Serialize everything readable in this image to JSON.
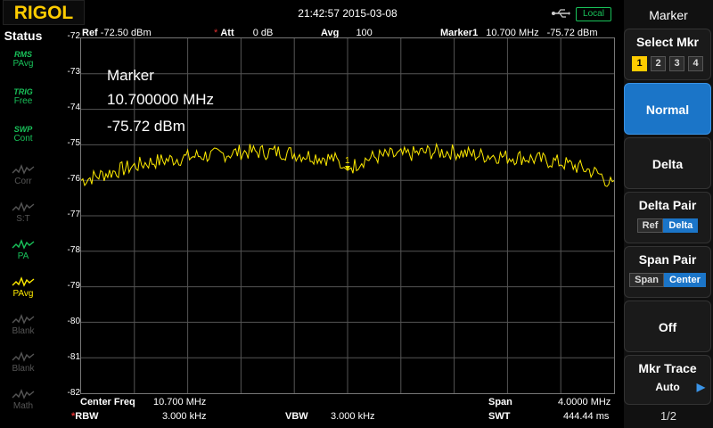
{
  "brand": "RIGOL",
  "header": {
    "datetime": "21:42:57 2015-03-08",
    "remote_badge": "Local"
  },
  "status": {
    "title": "Status",
    "items": [
      {
        "tag": "RMS",
        "label": "PAvg",
        "icon": "trace-avg-icon",
        "color": "#19c25a"
      },
      {
        "tag": "TRIG",
        "label": "Free",
        "icon": "trigger-icon",
        "color": "#19c25a"
      },
      {
        "tag": "SWP",
        "label": "Cont",
        "icon": "sweep-icon",
        "color": "#19c25a"
      },
      {
        "tag": "",
        "label": "Corr",
        "icon": "correction-icon",
        "color": "#555555"
      },
      {
        "tag": "",
        "label": "S:T",
        "icon": "stimulus-icon",
        "color": "#555555"
      },
      {
        "tag": "",
        "label": "PA",
        "icon": "preamp-icon",
        "color": "#19c25a"
      },
      {
        "tag": "",
        "label": "PAvg",
        "icon": "trace-yellow-icon",
        "color": "#ffeb00"
      },
      {
        "tag": "",
        "label": "Blank",
        "icon": "trace-blank-icon",
        "color": "#555555"
      },
      {
        "tag": "",
        "label": "Blank",
        "icon": "trace-blank-icon",
        "color": "#555555"
      },
      {
        "tag": "",
        "label": "Math",
        "icon": "math-icon",
        "color": "#555555"
      }
    ]
  },
  "info": {
    "ref_label": "Ref",
    "ref_value": "-72.50 dBm",
    "att_label": "Att",
    "att_value": "0 dB",
    "avg_label": "Avg",
    "avg_value": "100",
    "marker_label": "Marker1",
    "marker_freq": "10.700 MHz",
    "marker_level": "-75.72 dBm"
  },
  "marker_readout": {
    "title": "Marker",
    "freq": "10.700000 MHz",
    "level": "-75.72 dBm"
  },
  "footer": {
    "center_label": "Center Freq",
    "center_value": "10.700 MHz",
    "span_label": "Span",
    "span_value": "4.0000 MHz",
    "rbw_label": "RBW",
    "rbw_value": "3.000 kHz",
    "vbw_label": "VBW",
    "vbw_value": "3.000 kHz",
    "swt_label": "SWT",
    "swt_value": "444.44 ms"
  },
  "panel": {
    "title": "Marker",
    "select_mkr": {
      "label": "Select Mkr",
      "options": [
        "1",
        "2",
        "3",
        "4"
      ],
      "selected": "1"
    },
    "normal": "Normal",
    "delta": "Delta",
    "delta_pair": {
      "label": "Delta Pair",
      "options": [
        "Ref",
        "Delta"
      ],
      "selected": "Delta"
    },
    "span_pair": {
      "label": "Span Pair",
      "options": [
        "Span",
        "Center"
      ],
      "selected": "Center"
    },
    "off": "Off",
    "mkr_trace": {
      "label": "Mkr Trace",
      "value": "Auto"
    },
    "page": "1/2"
  },
  "chart_data": {
    "type": "line",
    "ylabel": "",
    "xlabel": "",
    "ytick_labels": [
      "-72",
      "-73",
      "-74",
      "-75",
      "-76",
      "-77",
      "-78",
      "-79",
      "-80",
      "-81",
      "-82"
    ],
    "ylim": [
      -82,
      -72
    ],
    "xlim_mhz": [
      8.7,
      12.7
    ],
    "grid": true,
    "trace_color": "#ffeb00",
    "series": [
      {
        "x_mhz": [
          8.7,
          8.8,
          8.9,
          9.0,
          9.1,
          9.2,
          9.3,
          9.4,
          9.5,
          9.6,
          9.7,
          9.8,
          9.9,
          10.0,
          10.1,
          10.2,
          10.3,
          10.4,
          10.5,
          10.6,
          10.7,
          10.8,
          10.9,
          11.0,
          11.1,
          11.2,
          11.3,
          11.4,
          11.5,
          11.6,
          11.7,
          11.8,
          11.9,
          12.0,
          12.1,
          12.2,
          12.3,
          12.4,
          12.5,
          12.6,
          12.7
        ],
        "values": [
          -76.0,
          -75.9,
          -75.8,
          -75.7,
          -75.6,
          -75.5,
          -75.45,
          -75.4,
          -75.35,
          -75.3,
          -75.3,
          -75.25,
          -75.2,
          -75.2,
          -75.2,
          -75.2,
          -75.25,
          -75.3,
          -75.35,
          -75.4,
          -75.72,
          -75.45,
          -75.35,
          -75.3,
          -75.3,
          -75.25,
          -75.2,
          -75.2,
          -75.2,
          -75.25,
          -75.3,
          -75.3,
          -75.35,
          -75.35,
          -75.4,
          -75.45,
          -75.5,
          -75.6,
          -75.7,
          -75.85,
          -76.2
        ],
        "marker": {
          "x_mhz": 10.7,
          "y": -75.72,
          "label": "1"
        }
      }
    ]
  }
}
